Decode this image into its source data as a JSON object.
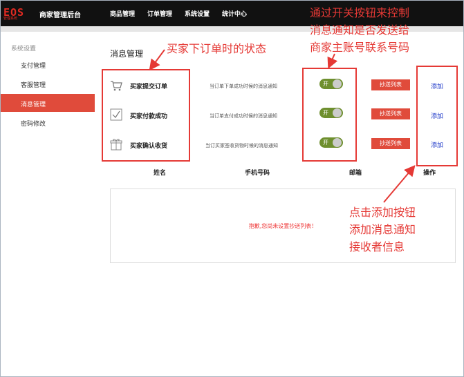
{
  "header": {
    "logo_text": "EOS",
    "logo_sub": "管理系统",
    "title": "商家管理后台",
    "nav": [
      "商品管理",
      "订单管理",
      "系统设置",
      "统计中心"
    ]
  },
  "sidebar": {
    "heading": "系统设置",
    "items": [
      {
        "label": "支付管理",
        "active": false
      },
      {
        "label": "客服管理",
        "active": false
      },
      {
        "label": "消息管理",
        "active": true
      },
      {
        "label": "密码修改",
        "active": false
      }
    ]
  },
  "main": {
    "title": "消息管理",
    "rows": [
      {
        "icon": "cart-icon",
        "label": "买家提交订单",
        "desc": "当订单下单成功时候的消息通知",
        "toggle": "开",
        "toggle_on": true,
        "cc_button": "抄送列表",
        "add": "添加"
      },
      {
        "icon": "checkbox-icon",
        "label": "买家付款成功",
        "desc": "当订单支付成功时候的消息通知",
        "toggle": "开",
        "toggle_on": true,
        "cc_button": "抄送列表",
        "add": "添加"
      },
      {
        "icon": "gift-icon",
        "label": "买家确认收货",
        "desc": "当订买家签收货物时候的消息通知",
        "toggle": "开",
        "toggle_on": true,
        "cc_button": "抄送列表",
        "add": "添加"
      }
    ],
    "table_headers": [
      "姓名",
      "手机号码",
      "邮箱",
      "操作"
    ],
    "empty_message": "抱歉,您尚未设置抄送列表！"
  },
  "annotations": {
    "status_note": "买家下订单时的状态",
    "toggle_note": [
      "通过开关按钮来控制",
      "消息通知是否发送给",
      "商家主账号联系号码"
    ],
    "add_note": [
      "点击添加按钮",
      "添加消息通知",
      "接收者信息"
    ]
  },
  "colors": {
    "topbar": "#111111",
    "accent": "#e04b3b",
    "toggle_on": "#6e8f2e",
    "link": "#1a35c8",
    "annotation": "#e53935"
  }
}
